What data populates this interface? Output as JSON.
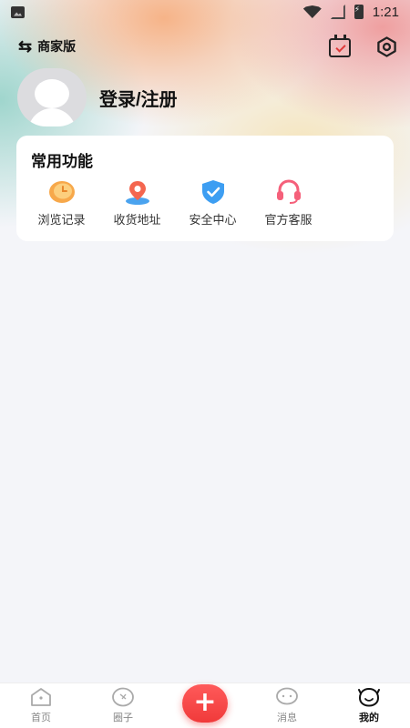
{
  "status_bar": {
    "time": "1:21"
  },
  "header": {
    "switch_label": "商家版",
    "switch_icon": "⇆"
  },
  "profile": {
    "login_label": "登录/注册"
  },
  "functions": {
    "title": "常用功能",
    "items": [
      {
        "label": "浏览记录",
        "icon": "clock-icon"
      },
      {
        "label": "收货地址",
        "icon": "location-pin-icon"
      },
      {
        "label": "安全中心",
        "icon": "shield-icon"
      },
      {
        "label": "官方客服",
        "icon": "headset-icon"
      }
    ]
  },
  "bottom_nav": {
    "items": [
      {
        "label": "首页"
      },
      {
        "label": "圈子"
      },
      {
        "label": "消息"
      },
      {
        "label": "我的"
      }
    ],
    "plus_symbol": "+",
    "active": "我的"
  },
  "colors": {
    "accent": "#f03a3a",
    "card_bg": "#ffffff",
    "page_bg": "#f4f5f9"
  }
}
